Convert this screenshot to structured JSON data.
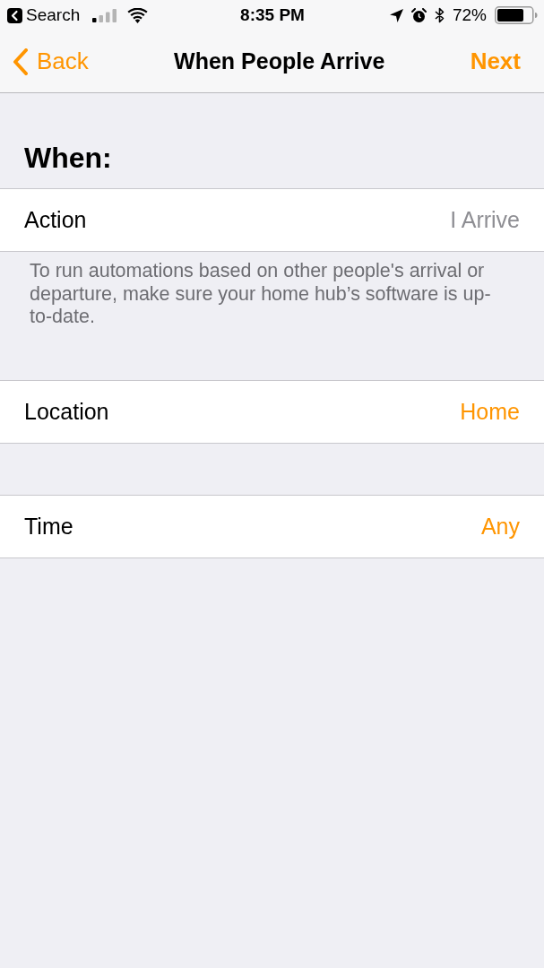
{
  "status_bar": {
    "back_app": "Search",
    "time": "8:35 PM",
    "battery": "72%"
  },
  "nav_bar": {
    "back": "Back",
    "title": "When People Arrive",
    "next": "Next"
  },
  "sections": [
    {
      "header": "When:",
      "rows": [
        {
          "label": "Action",
          "value": "I Arrive",
          "editable": false
        }
      ],
      "footer": "To run automations based on other people's arrival or departure, make sure your home hub’s software is up-to-date."
    },
    {
      "rows": [
        {
          "label": "Location",
          "value": "Home",
          "editable": true
        }
      ]
    },
    {
      "rows": [
        {
          "label": "Time",
          "value": "Any",
          "editable": true
        }
      ]
    }
  ]
}
